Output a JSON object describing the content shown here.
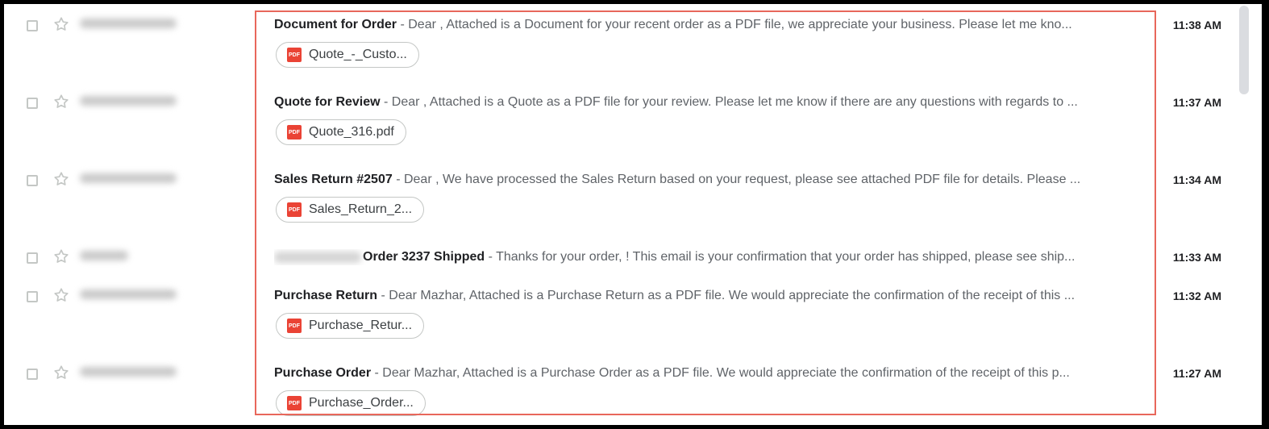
{
  "colors": {
    "accent": "#1a73e8",
    "highlight": "#e8675b",
    "pdf": "#ea4335"
  },
  "pdf_icon_text": "PDF",
  "emails": [
    {
      "subject": "Document for Order",
      "separator": " - ",
      "snippet": "Dear , Attached is a Document for your recent order as a PDF file, we appreciate your business. Please let me kno...",
      "attachment": "Quote_-_Custo...",
      "time": "11:38 AM"
    },
    {
      "subject": "Quote for Review",
      "separator": " - ",
      "snippet": "Dear , Attached is a Quote as a PDF file for your review. Please let me know if there are any questions with regards to ...",
      "attachment": "Quote_316.pdf",
      "time": "11:37 AM"
    },
    {
      "subject": "Sales Return #2507",
      "separator": " - ",
      "snippet": "Dear , We have processed the Sales Return based on your request, please see attached PDF file for details. Please ...",
      "attachment": "Sales_Return_2...",
      "time": "11:34 AM"
    },
    {
      "subject": "Order 3237 Shipped",
      "separator": " - ",
      "snippet": "Thanks for your order, ! This email is your confirmation that your order has shipped, please see ship...",
      "time": "11:33 AM"
    },
    {
      "subject": "Purchase Return",
      "separator": " - ",
      "snippet": "Dear Mazhar, Attached is a Purchase Return as a PDF file. We would appreciate the confirmation of the receipt of this ...",
      "attachment": "Purchase_Retur...",
      "time": "11:32 AM"
    },
    {
      "subject": "Purchase Order",
      "separator": " - ",
      "snippet": "Dear Mazhar, Attached is a Purchase Order as a PDF file. We would appreciate the confirmation of the receipt of this p...",
      "attachment": "Purchase_Order...",
      "time": "11:27 AM"
    }
  ]
}
